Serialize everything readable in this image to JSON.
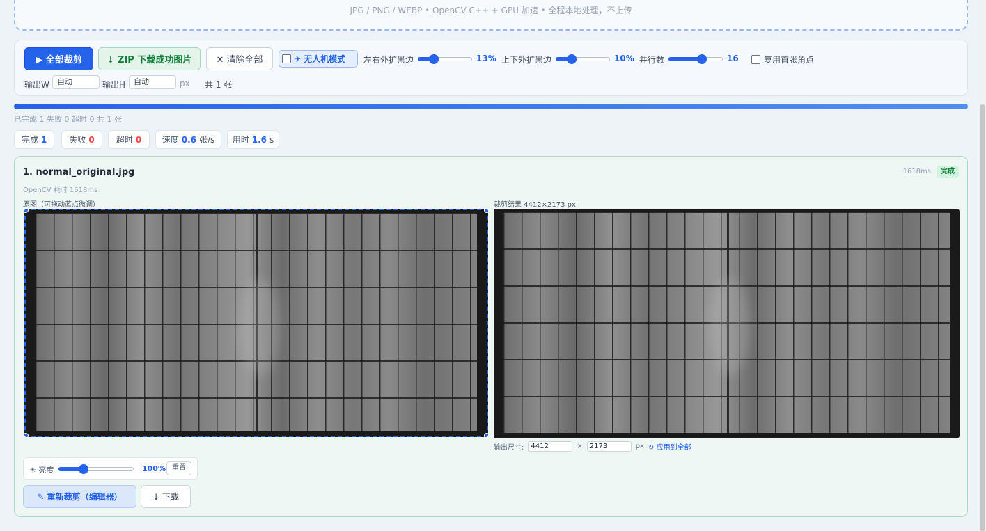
{
  "dropzone": {
    "hint": "JPG / PNG / WEBP  •  OpenCV C++ + GPU 加速  •  全程本地处理，不上传"
  },
  "toolbar": {
    "crop_all_label": "▶ 全部裁剪",
    "zip_label": "↓ ZIP 下载成功图片",
    "clear_label": "✕ 清除全部",
    "drone_mode_label": "✈ 无人机模式",
    "drone_mode_checked": false,
    "lr_pad_label": "左右外扩黑边",
    "lr_pad_value_text": "13%",
    "lr_pad_fraction": 0.3,
    "tb_pad_label": "上下外扩黑边",
    "tb_pad_value_text": "10%",
    "tb_pad_fraction": 0.3,
    "parallel_label": "并行数",
    "parallel_value_text": "16",
    "parallel_fraction": 0.62,
    "reuse_corners_label": "复用首张角点",
    "reuse_corners_checked": false,
    "out_w_label": "输出W",
    "out_w_value": "自动",
    "out_h_label": "输出H",
    "out_h_value": "自动",
    "px_unit": "px",
    "total_count": "共 1 张"
  },
  "progress": {
    "fraction": 1.0,
    "text": "已完成 1 失败 0 超时 0 共 1 张"
  },
  "stats": {
    "done_label": "完成",
    "done_value": "1",
    "fail_label": "失败",
    "fail_value": "0",
    "timeout_label": "超时",
    "timeout_value": "0",
    "speed_label": "速度",
    "speed_value": "0.6",
    "speed_unit": "张/s",
    "elapsed_label": "用时",
    "elapsed_value": "1.6",
    "elapsed_unit": "s"
  },
  "card": {
    "title": "1. normal_original.jpg",
    "time": "1618ms",
    "status_badge": "完成",
    "subtitle": "OpenCV 耗时 1618ms",
    "original_label": "原图（可拖动蓝点微调）",
    "result_label": "裁剪结果   4412×2173 px",
    "output_size_label": "输出尺寸:",
    "output_w": "4412",
    "times_sign": "×",
    "output_h": "2173",
    "px_unit": "px",
    "apply_all_label": "↻ 应用到全部",
    "brightness_label": "☀ 亮度",
    "brightness_value_text": "100%",
    "brightness_fraction": 0.33,
    "reset_label": "重置",
    "recrop_label": "✎ 重新裁剪（编辑器）",
    "download_label": "↓ 下载"
  },
  "colors": {
    "accent": "#2563eb",
    "success": "#15803d",
    "danger": "#ef4444"
  }
}
